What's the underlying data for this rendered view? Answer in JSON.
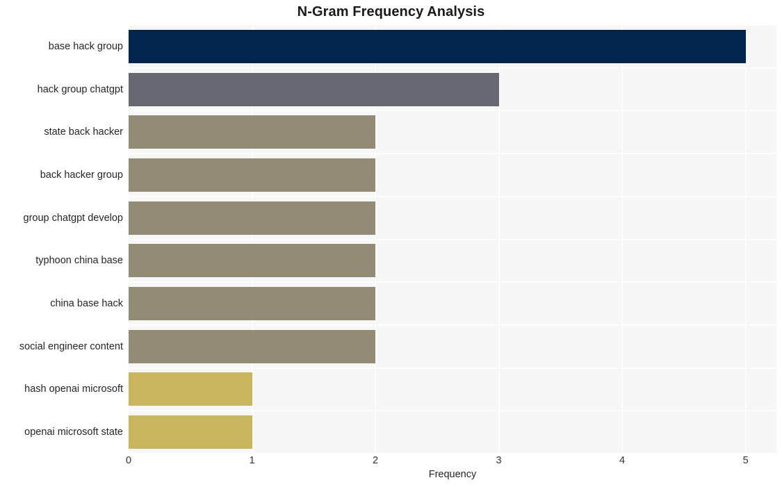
{
  "chart_data": {
    "type": "bar",
    "orientation": "horizontal",
    "title": "N-Gram Frequency Analysis",
    "xlabel": "Frequency",
    "ylabel": "",
    "xlim": [
      0,
      5.25
    ],
    "xticks": [
      "0",
      "1",
      "2",
      "3",
      "4",
      "5"
    ],
    "xtick_values": [
      0,
      1,
      2,
      3,
      4,
      5
    ],
    "grid": true,
    "legend": "none",
    "categories": [
      "base hack group",
      "hack group chatgpt",
      "state back hacker",
      "back hacker group",
      "group chatgpt develop",
      "typhoon china base",
      "china base hack",
      "social engineer content",
      "hash openai microsoft",
      "openai microsoft state"
    ],
    "values": [
      5,
      3,
      2,
      2,
      2,
      2,
      2,
      2,
      1,
      1
    ],
    "bar_colors": [
      "#03244d",
      "#666971",
      "#918c73",
      "#918c73",
      "#918c73",
      "#918c73",
      "#918c73",
      "#918c73",
      "#c8b55e",
      "#c8b55e"
    ],
    "plot_background": "#f7f7f7",
    "gridline_color": "#fdfdfd",
    "figure_background": "#ffffff"
  }
}
